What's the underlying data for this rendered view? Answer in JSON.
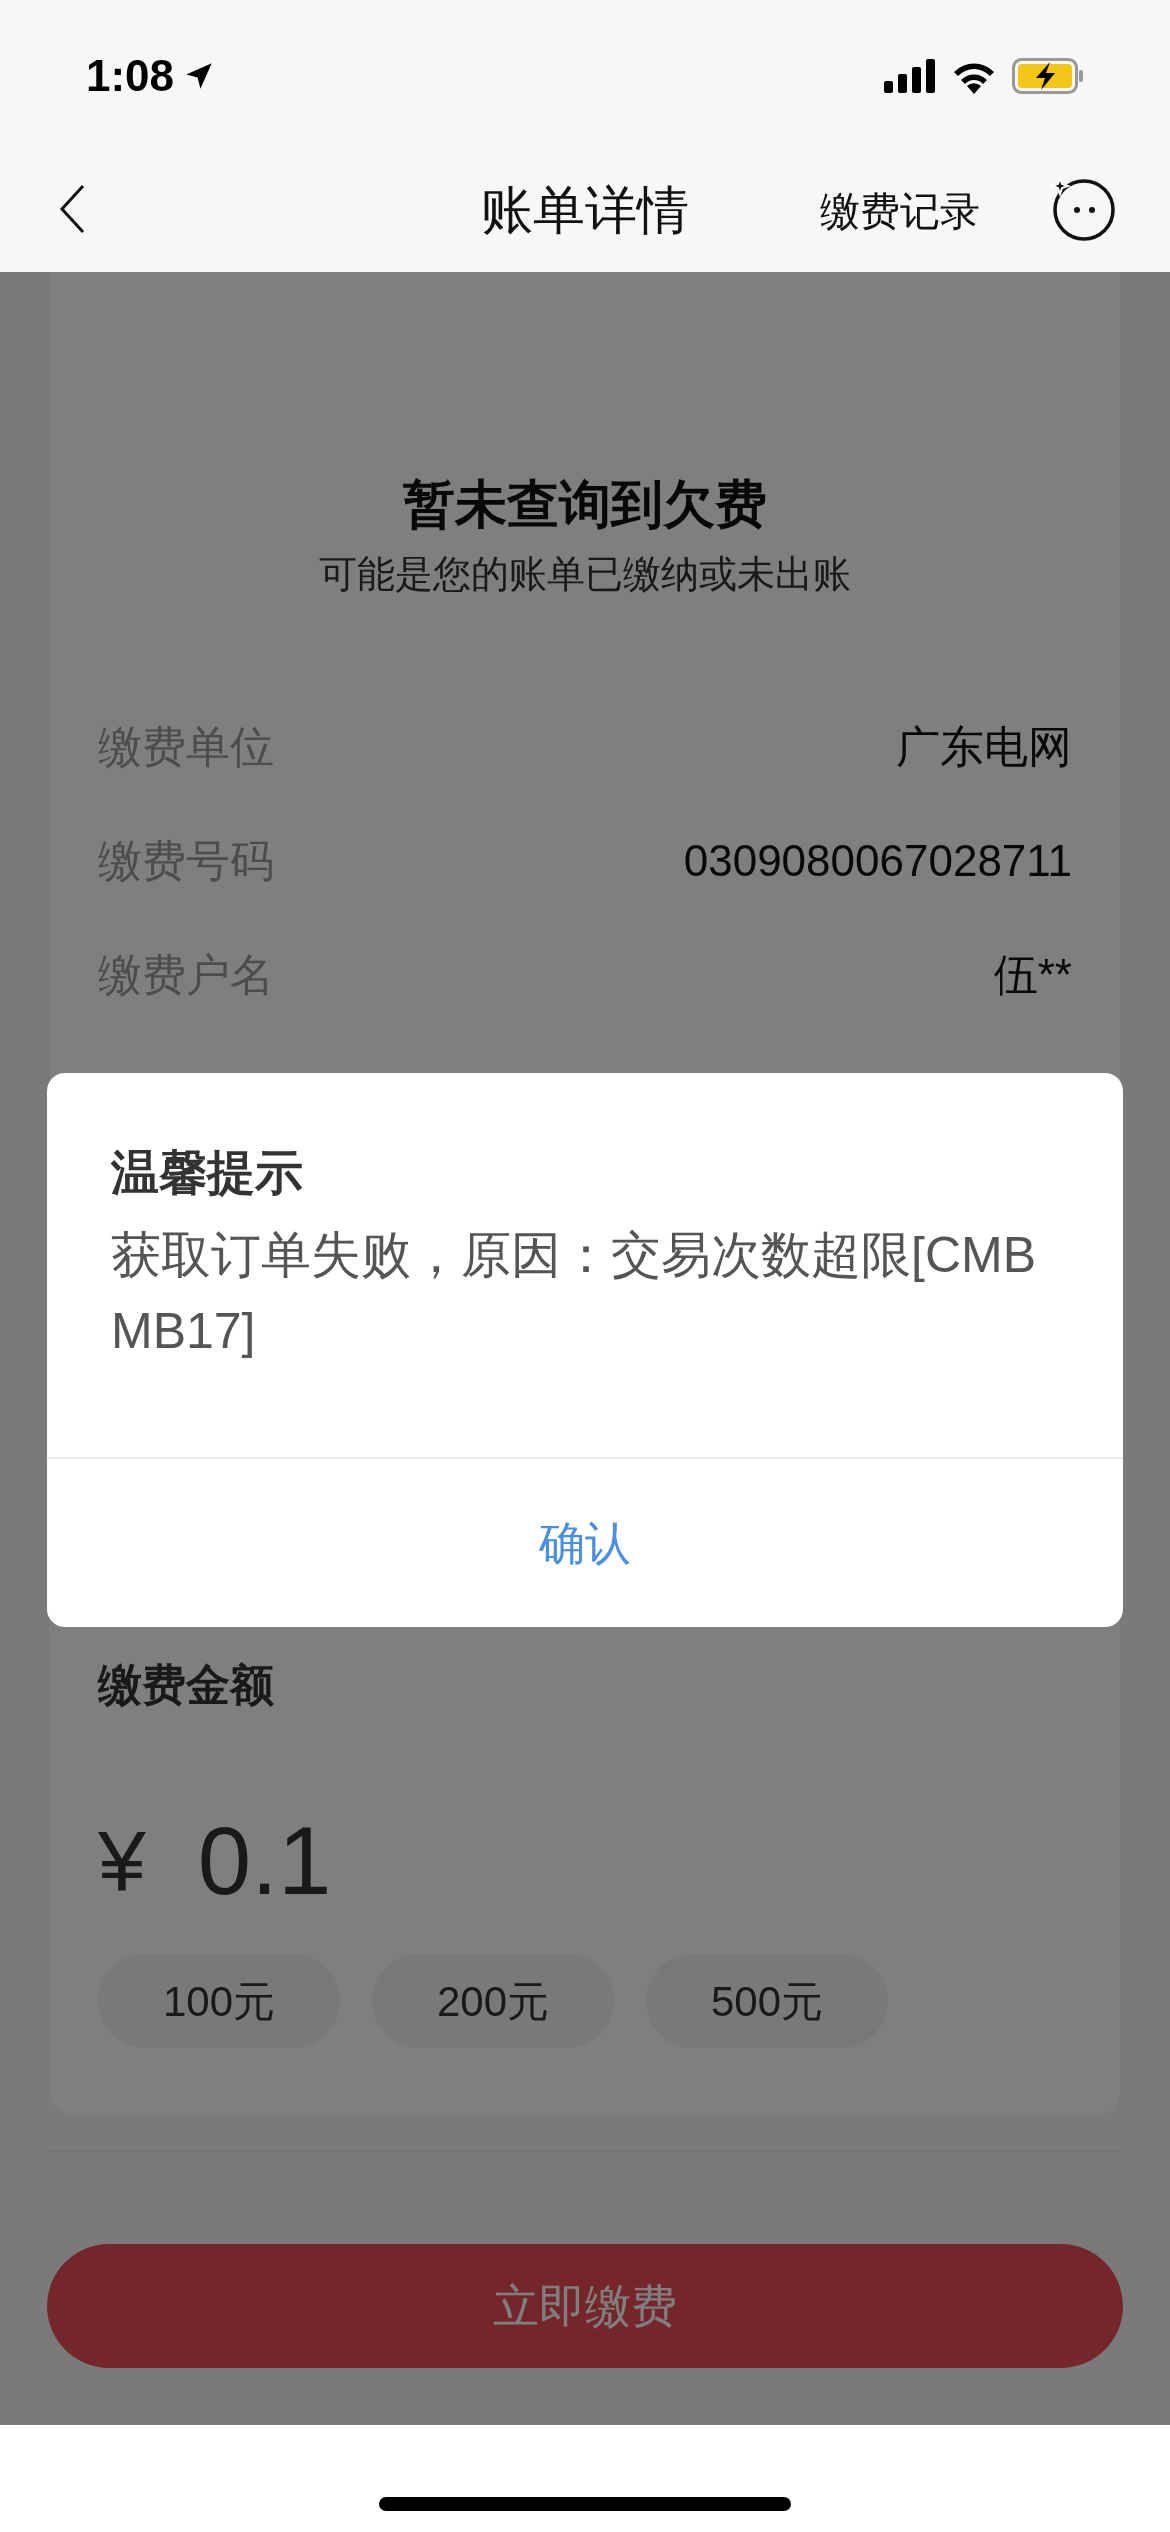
{
  "status_bar": {
    "time": "1:08"
  },
  "nav": {
    "title": "账单详情",
    "action": "缴费记录"
  },
  "summary": {
    "title": "暂未查询到欠费",
    "subtitle": "可能是您的账单已缴纳或未出账"
  },
  "details": [
    {
      "label": "缴费单位",
      "value": "广东电网"
    },
    {
      "label": "缴费号码",
      "value": "0309080067028711"
    },
    {
      "label": "缴费户名",
      "value": "伍**"
    }
  ],
  "amount": {
    "label": "缴费金额",
    "currency": "¥",
    "value": "0.1",
    "presets": [
      "100元",
      "200元",
      "500元"
    ]
  },
  "pay_button": {
    "label": "立即缴费"
  },
  "dialog": {
    "title": "温馨提示",
    "message": "获取订单失败，原因：交易次数超限[CMBMB17]",
    "confirm": "确认"
  }
}
